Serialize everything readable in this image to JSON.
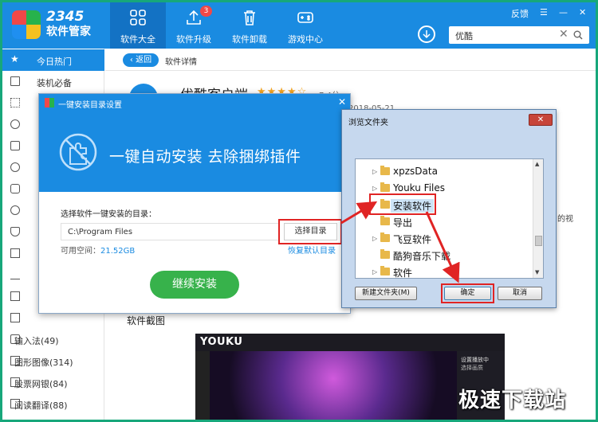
{
  "header": {
    "logo_number": "2345",
    "logo_name": "软件管家",
    "nav": [
      {
        "label": "软件大全",
        "icon": "grid-icon"
      },
      {
        "label": "软件升级",
        "icon": "upload-icon",
        "badge": "3"
      },
      {
        "label": "软件卸载",
        "icon": "trash-icon"
      },
      {
        "label": "游戏中心",
        "icon": "gamepad-icon"
      }
    ],
    "feedback": "反馈",
    "search_value": "优酷",
    "colors": {
      "header": "#1a8be1",
      "active": "#1372c4",
      "frame": "#17a77b"
    }
  },
  "sidebar": {
    "items": [
      {
        "label": "今日热门",
        "icon": "star-icon"
      },
      {
        "label": "装机必备",
        "icon": "monitor-icon"
      },
      {
        "label": "",
        "icon": "apps-icon"
      },
      {
        "label": "",
        "icon": "browser-icon"
      },
      {
        "label": "",
        "icon": "chat-icon"
      },
      {
        "label": "",
        "icon": "video-icon"
      },
      {
        "label": "",
        "icon": "game-icon"
      },
      {
        "label": "",
        "icon": "music-icon"
      },
      {
        "label": "",
        "icon": "shield-icon"
      },
      {
        "label": "",
        "icon": "puzzle-icon"
      },
      {
        "label": "",
        "icon": "download-icon"
      },
      {
        "label": "",
        "icon": "word-icon"
      },
      {
        "label": "",
        "icon": "desktop-icon"
      },
      {
        "label": "输入法(49)",
        "icon": "keyboard-icon"
      },
      {
        "label": "图形图像(314)",
        "icon": "image-icon"
      },
      {
        "label": "股票网银(84)",
        "icon": "stock-icon"
      },
      {
        "label": "阅读翻译(88)",
        "icon": "book-icon"
      }
    ]
  },
  "detail": {
    "back_label": "返回",
    "crumb": "软件详情",
    "app_name": "优酷客户端",
    "rating": "7.4分",
    "date": "2018-05-21",
    "side_snippet": "的视",
    "screenshots_title": "软件截图",
    "shot": {
      "logo": "YOUKU",
      "side_title": "设置播放中",
      "side_text": "选择画质"
    }
  },
  "setup_dialog": {
    "title": "一键安装目录设置",
    "banner": "一键自动安装 去除捆绑插件",
    "dir_label": "选择软件一键安装的目录：",
    "dir_value": "C:\\Program Files",
    "choose_button": "选择目录",
    "space_label": "可用空间：",
    "space_value": "21.52GB",
    "restore_link": "恢复默认目录",
    "install_button": "继续安装"
  },
  "browse_dialog": {
    "title": "浏览文件夹",
    "close_label": "✕",
    "folders": [
      {
        "name": "xpzsData",
        "expandable": true,
        "selected": false
      },
      {
        "name": "Youku Files",
        "expandable": true,
        "selected": false
      },
      {
        "name": "安装软件",
        "expandable": false,
        "selected": true
      },
      {
        "name": "导出",
        "expandable": false,
        "selected": false
      },
      {
        "name": "飞豆软件",
        "expandable": true,
        "selected": false
      },
      {
        "name": "酷狗音乐下载",
        "expandable": false,
        "selected": false
      },
      {
        "name": "软件",
        "expandable": true,
        "selected": false
      }
    ],
    "new_folder_button": "新建文件夹(M)",
    "ok_button": "确定",
    "cancel_button": "取消"
  },
  "watermark": "极速下载站"
}
